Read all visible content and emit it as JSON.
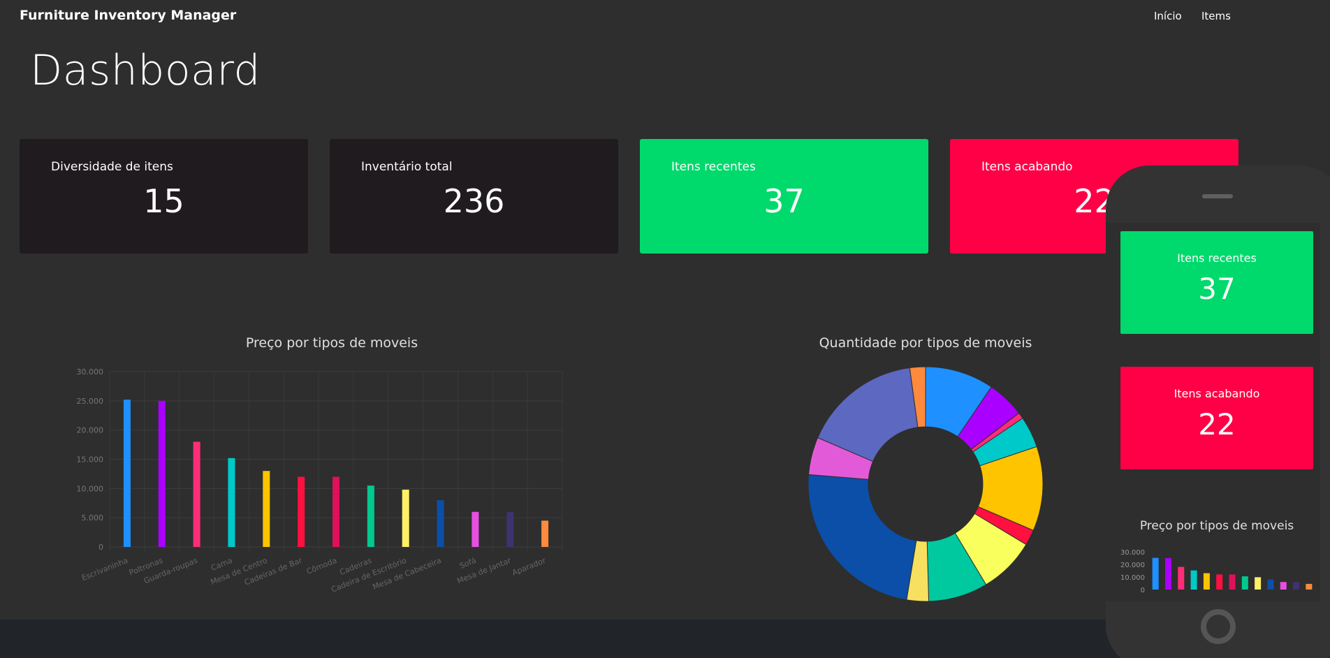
{
  "navbar": {
    "brand": "Furniture Inventory Manager",
    "links": [
      "Início",
      "Items"
    ]
  },
  "page": {
    "title": "Dashboard"
  },
  "cards": [
    {
      "label": "Diversidade de itens",
      "value": "15",
      "color": "#1f1b1f"
    },
    {
      "label": "Inventário total",
      "value": "236",
      "color": "#1f1b1f"
    },
    {
      "label": "Itens recentes",
      "value": "37",
      "color": "#00d96b"
    },
    {
      "label": "Itens acabando",
      "value": "22",
      "color": "#ff0046"
    }
  ],
  "chart_data": [
    {
      "type": "bar",
      "title": "Preço por tipos de moveis",
      "categories": [
        "Escrivaninha",
        "Poltronas",
        "Guarda-roupas",
        "Cama",
        "Mesa de Centro",
        "Cadeiras de Bar",
        "Cômoda",
        "Cadeiras",
        "Cadeira de Escritório",
        "Mesa de Cabeceira",
        "Sofá",
        "Mesa de Jantar",
        "Aparador"
      ],
      "values": [
        25200,
        25000,
        18000,
        15200,
        13000,
        12000,
        12000,
        10500,
        9800,
        8000,
        6000,
        6000,
        4500
      ],
      "colors": [
        "#1e90ff",
        "#aa00ff",
        "#ff2d78",
        "#00c9c9",
        "#ffc400",
        "#ff1040",
        "#e0105a",
        "#00c98f",
        "#fff066",
        "#0b4fa8",
        "#e74fe0",
        "#3f3270",
        "#ff8a3d"
      ],
      "ylim": [
        0,
        30000
      ],
      "yticks": [
        "30.000",
        "25.000",
        "20.000",
        "15.000",
        "10.000",
        "5.000",
        "0"
      ],
      "grid": true
    },
    {
      "type": "pie",
      "title": "Quantidade por tipos de moveis",
      "values": [
        22,
        12,
        2,
        10,
        27,
        5,
        18,
        19,
        7,
        55,
        12,
        38,
        5
      ],
      "colors": [
        "#1e90ff",
        "#aa00ff",
        "#ff2d78",
        "#00c9c9",
        "#ffc400",
        "#ff1040",
        "#f9ff5c",
        "#00c9a0",
        "#f7e060",
        "#0b4fa8",
        "#e35ad8",
        "#5d68c0",
        "#ff8a3d"
      ]
    },
    {
      "type": "bar",
      "title": "Preço por tipos de moveis",
      "values": [
        25200,
        25000,
        18000,
        15200,
        13000,
        12000,
        12000,
        10500,
        9800,
        8000,
        6000,
        6000,
        4500
      ],
      "colors": [
        "#1e90ff",
        "#aa00ff",
        "#ff2d78",
        "#00c9c9",
        "#ffc400",
        "#ff1040",
        "#e0105a",
        "#00c98f",
        "#fff066",
        "#0b4fa8",
        "#e74fe0",
        "#3f3270",
        "#ff8a3d"
      ],
      "ylim": [
        0,
        30000
      ],
      "yticks": [
        "30.000",
        "20.000",
        "10.000",
        "0"
      ]
    }
  ],
  "mobile": {
    "cards": [
      {
        "label": "Itens recentes",
        "value": "37",
        "color": "#00d96b"
      },
      {
        "label": "Itens acabando",
        "value": "22",
        "color": "#ff0046"
      }
    ],
    "chart_title": "Preço por tipos de moveis"
  }
}
